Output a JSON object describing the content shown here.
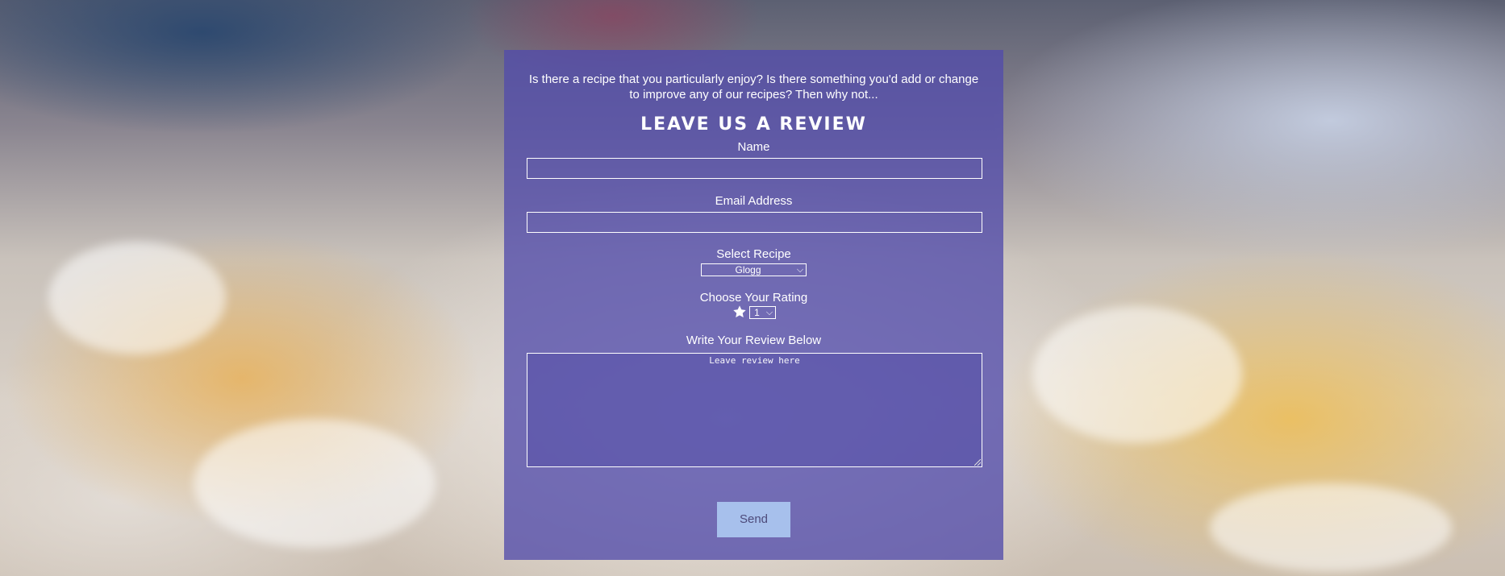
{
  "form": {
    "intro": "Is there a recipe that you particularly enjoy? Is there something you'd add or change to improve any of our recipes? Then why not...",
    "heading": "Leave us a review",
    "name_label": "Name",
    "name_value": "",
    "email_label": "Email Address",
    "email_value": "",
    "recipe_label": "Select Recipe",
    "recipe_selected": "Glogg",
    "rating_label": "Choose Your Rating",
    "rating_icon": "star-icon",
    "rating_selected": "1",
    "review_label": "Write Your Review Below",
    "review_placeholder": "Leave review here",
    "send_label": "Send"
  },
  "colors": {
    "panel": "#524caa",
    "send_button": "#a7c0ec",
    "text": "#ffffff"
  }
}
